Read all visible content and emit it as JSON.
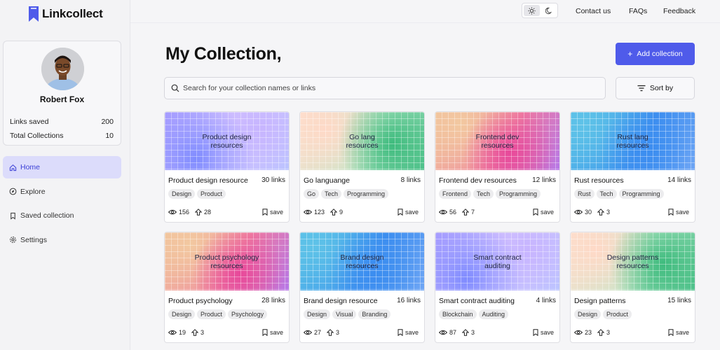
{
  "app": {
    "name": "Linkcollect"
  },
  "profile": {
    "name": "Robert Fox",
    "stats": [
      {
        "label": "Links saved",
        "value": "200"
      },
      {
        "label": "Total Collections",
        "value": "10"
      }
    ]
  },
  "nav": [
    {
      "label": "Home",
      "icon": "home-icon",
      "active": true
    },
    {
      "label": "Explore",
      "icon": "compass-icon",
      "active": false
    },
    {
      "label": "Saved collection",
      "icon": "bookmark-icon",
      "active": false
    },
    {
      "label": "Settings",
      "icon": "gear-icon",
      "active": false
    }
  ],
  "topbar": {
    "links": [
      "Contact us",
      "FAQs",
      "Feedback"
    ]
  },
  "main": {
    "title": "My Collection,",
    "add_button": "Add collection",
    "search_placeholder": "Search for your collection names or links",
    "sort_button": "Sort by",
    "save_label": "save"
  },
  "cards": [
    {
      "cover": "Product design\nresources",
      "name": "Product design resource",
      "count": "30 links",
      "tags": [
        "Design",
        "Product"
      ],
      "views": "156",
      "upvotes": "28",
      "gradient": "purple"
    },
    {
      "cover": "Go lang\nresources",
      "name": "Go languange",
      "count": "8 links",
      "tags": [
        "Go",
        "Tech",
        "Programming"
      ],
      "views": "123",
      "upvotes": "9",
      "gradient": "green"
    },
    {
      "cover": "Frontend dev\nresources",
      "name": "Frontend dev resources",
      "count": "12 links",
      "tags": [
        "Frontend",
        "Tech",
        "Programming"
      ],
      "views": "56",
      "upvotes": "7",
      "gradient": "pink"
    },
    {
      "cover": "Rust lang\nresources",
      "name": "Rust resources",
      "count": "14 links",
      "tags": [
        "Rust",
        "Tech",
        "Programming"
      ],
      "views": "30",
      "upvotes": "3",
      "gradient": "blue"
    },
    {
      "cover": "Product psychology\nresources",
      "name": "Product psychology",
      "count": "28 links",
      "tags": [
        "Design",
        "Product",
        "Psychology"
      ],
      "views": "19",
      "upvotes": "3",
      "gradient": "pink"
    },
    {
      "cover": "Brand design\nresources",
      "name": "Brand design resource",
      "count": "16 links",
      "tags": [
        "Design",
        "Visual",
        "Branding"
      ],
      "views": "27",
      "upvotes": "3",
      "gradient": "blue"
    },
    {
      "cover": "Smart contract\nauditing",
      "name": "Smart contract auditing",
      "count": "4 links",
      "tags": [
        "Blockchain",
        "Auditing"
      ],
      "views": "87",
      "upvotes": "3",
      "gradient": "purple"
    },
    {
      "cover": "Design patterns\nresources",
      "name": "Design patterns",
      "count": "15 links",
      "tags": [
        "Design",
        "Product"
      ],
      "views": "23",
      "upvotes": "3",
      "gradient": "green"
    }
  ],
  "colors": {
    "accent": "#4f5bea",
    "nav_active_bg": "#dcdcfb",
    "nav_active_text": "#3b3fd6"
  }
}
